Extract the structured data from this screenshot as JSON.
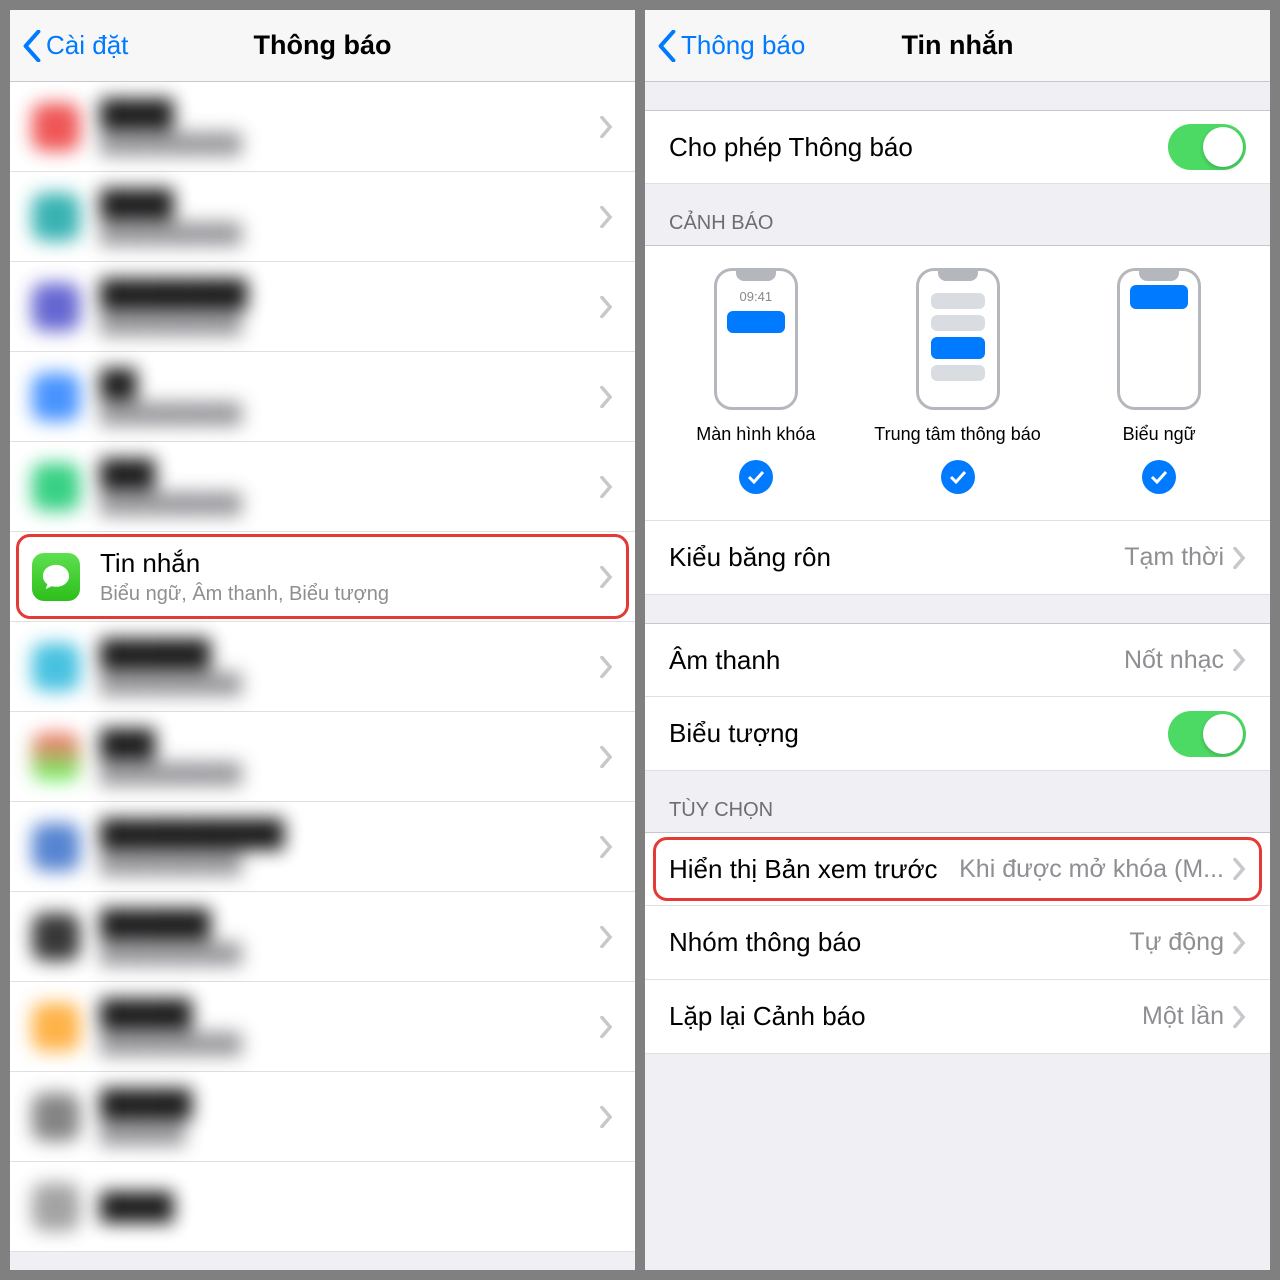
{
  "left": {
    "back": "Cài đặt",
    "title": "Thông báo",
    "messages": {
      "title": "Tin nhắn",
      "subtitle": "Biểu ngữ, Âm thanh, Biểu tượng"
    }
  },
  "right": {
    "back": "Thông báo",
    "title": "Tin nhắn",
    "allow_label": "Cho phép Thông báo",
    "alerts_header": "CẢNH BÁO",
    "alerts": {
      "lockscreen": "Màn hình khóa",
      "center": "Trung tâm thông báo",
      "banner": "Biểu ngữ",
      "lockscreen_time": "09:41"
    },
    "banner_style": {
      "label": "Kiểu băng rôn",
      "value": "Tạm thời"
    },
    "sound": {
      "label": "Âm thanh",
      "value": "Nốt nhạc"
    },
    "badge": {
      "label": "Biểu tượng"
    },
    "options_header": "TÙY CHỌN",
    "preview": {
      "label": "Hiển thị Bản xem trước",
      "value": "Khi được mở khóa (M..."
    },
    "grouping": {
      "label": "Nhóm thông báo",
      "value": "Tự động"
    },
    "repeat": {
      "label": "Lặp lại Cảnh báo",
      "value": "Một lần"
    }
  },
  "colors": {
    "accent": "#007aff",
    "switch_on": "#4cd964",
    "highlight": "#e53935"
  }
}
